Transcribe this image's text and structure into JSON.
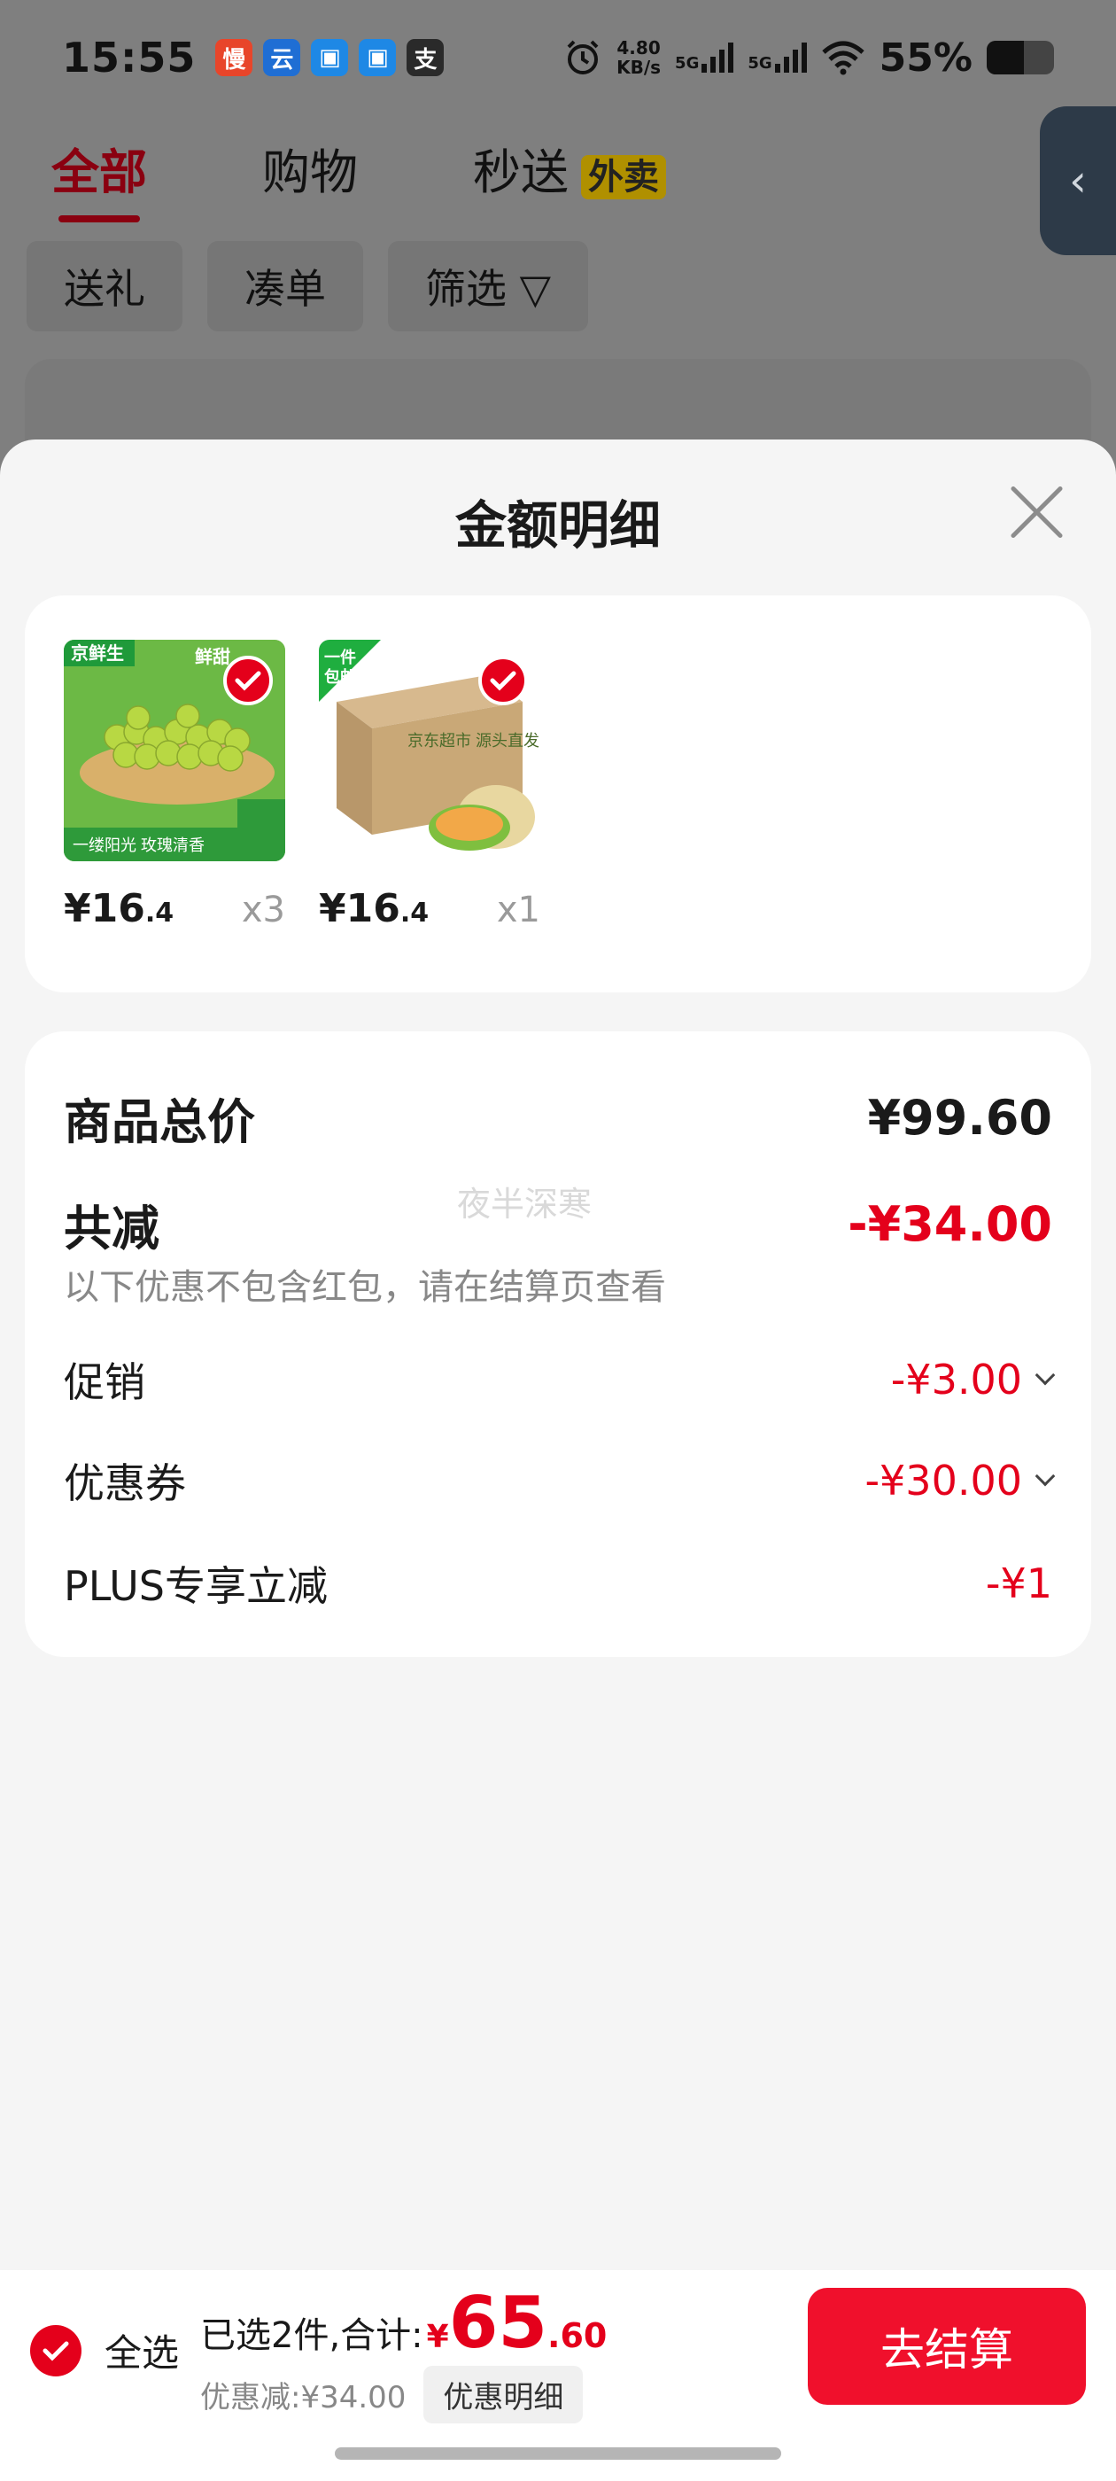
{
  "status_bar": {
    "time": "15:55",
    "net_speed_value": "4.80",
    "net_speed_unit": "KB/s",
    "sim1": "5G",
    "sim2": "5G",
    "battery": "55%",
    "battery_level": 0.55,
    "app_icons": [
      {
        "name": "app-manman-icon",
        "color": "#e8452a",
        "glyph": "慢"
      },
      {
        "name": "app-cloud-icon",
        "color": "#1f6ed4",
        "glyph": "云"
      },
      {
        "name": "app-blue1-icon",
        "color": "#1e88e5",
        "glyph": "▣"
      },
      {
        "name": "app-blue2-icon",
        "color": "#1e88e5",
        "glyph": "▣"
      },
      {
        "name": "app-pay-icon",
        "color": "#2a2a2a",
        "glyph": "支"
      }
    ]
  },
  "background_page": {
    "tabs": [
      {
        "label": "全部",
        "active": true
      },
      {
        "label": "购物",
        "active": false
      },
      {
        "label": "秒送",
        "active": false
      }
    ],
    "takeout_badge": "外卖",
    "filters": [
      "送礼",
      "凑单",
      "筛选"
    ]
  },
  "sheet": {
    "title": "金额明细",
    "products": [
      {
        "price_int": "¥16",
        "price_frac": ".4",
        "qty": "x3",
        "image": "green-grapes",
        "checked": true
      },
      {
        "price_int": "¥16",
        "price_frac": ".4",
        "qty": "x1",
        "image": "melon-box",
        "checked": true
      }
    ],
    "product_badges": {
      "brand": "京鲜生",
      "tag": "鲜甜",
      "free_ship": "一件\n包邮",
      "slogan": "一缕阳光 玫瑰清香",
      "box_text": "京东超市 源头直发"
    },
    "summary": {
      "total_label": "商品总价",
      "total_value": "¥99.60",
      "reduce_label": "共减",
      "reduce_value": "-¥34.00",
      "note": "以下优惠不包含红包，请在结算页查看",
      "watermark": "夜半深寒",
      "items": [
        {
          "label": "促销",
          "value": "-¥3.00",
          "expandable": true
        },
        {
          "label": "优惠券",
          "value": "-¥30.00",
          "expandable": true
        },
        {
          "label": "PLUS专享立减",
          "value": "-¥1",
          "expandable": false
        }
      ]
    }
  },
  "bottom_bar": {
    "select_all_label": "全选",
    "selected_text": "已选2件,合计:",
    "currency": "¥",
    "total_int": "65",
    "total_frac": ".60",
    "discount_text": "优惠减:¥34.00",
    "detail_button": "优惠明细",
    "checkout_button": "去结算"
  },
  "colors": {
    "accent": "#e4001b",
    "checkout": "#f0102c",
    "sheet_bg": "#f5f5f5"
  }
}
